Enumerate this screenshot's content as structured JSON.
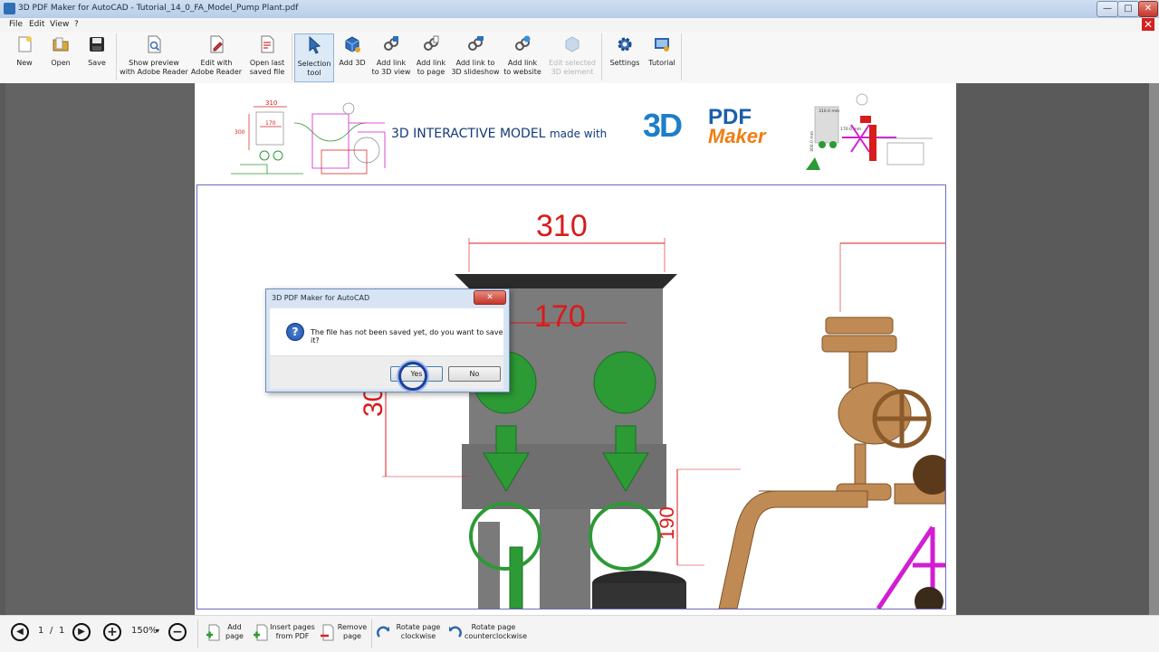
{
  "window": {
    "title": "3D PDF Maker for AutoCAD - Tutorial_14_0_FA_Model_Pump Plant.pdf",
    "controls": {
      "minimize": "—",
      "maximize": "□",
      "close": "✕"
    }
  },
  "menu": {
    "items": [
      "File",
      "Edit",
      "View",
      "?"
    ],
    "doc_close": "✕"
  },
  "toolbar": {
    "items": [
      {
        "label_1": "New",
        "label_2": "",
        "icon": "new-file-icon"
      },
      {
        "label_1": "Open",
        "label_2": "",
        "icon": "open-folder-icon"
      },
      {
        "label_1": "Save",
        "label_2": "",
        "icon": "save-disk-icon"
      },
      {
        "label_1": "Show preview",
        "label_2": "with Adobe Reader",
        "icon": "preview-pdf-icon"
      },
      {
        "label_1": "Edit with",
        "label_2": "Adobe Reader",
        "icon": "edit-pdf-icon"
      },
      {
        "label_1": "Open last",
        "label_2": "saved file",
        "icon": "open-last-icon"
      },
      {
        "label_1": "Selection",
        "label_2": "tool",
        "icon": "cursor-arrow-icon"
      },
      {
        "label_1": "Add 3D",
        "label_2": "",
        "icon": "add-3d-cube-icon"
      },
      {
        "label_1": "Add link",
        "label_2": "to 3D view",
        "icon": "link-3d-view-icon"
      },
      {
        "label_1": "Add link",
        "label_2": "to page",
        "icon": "link-page-icon"
      },
      {
        "label_1": "Add link to",
        "label_2": "3D slideshow",
        "icon": "link-slideshow-icon"
      },
      {
        "label_1": "Add link",
        "label_2": "to website",
        "icon": "link-website-icon"
      },
      {
        "label_1": "Edit selected",
        "label_2": "3D element",
        "icon": "edit-3d-element-icon"
      },
      {
        "label_1": "Settings",
        "label_2": "",
        "icon": "gear-icon"
      },
      {
        "label_1": "Tutorial",
        "label_2": "",
        "icon": "tutorial-icon"
      }
    ]
  },
  "document": {
    "banner_title": "3D INTERACTIVE MODEL",
    "banner_suffix": "made with",
    "brand": {
      "mark": "3D",
      "line1": "PDF",
      "line2": "Maker"
    },
    "dimensions": [
      "310",
      "170",
      "300",
      "190"
    ],
    "thumb_dims": {
      "left": [
        "310",
        "170",
        "300"
      ],
      "right": [
        "310.0 mm",
        "170.0 mm",
        "300.0 mm"
      ]
    }
  },
  "dialog": {
    "title": "3D PDF Maker for AutoCAD",
    "close": "✕",
    "icon": "question-icon",
    "icon_glyph": "?",
    "message": "The file has not been saved yet, do you want to save it?",
    "yes_label": "Yes",
    "no_label": "No"
  },
  "statusbar": {
    "current_page": "1",
    "page_sep": "/",
    "total_pages": "1",
    "zoom": "150%",
    "zoom_caret": "▾",
    "prev_glyph": "◀",
    "next_glyph": "▶",
    "zoom_in_glyph": "+",
    "zoom_out_glyph": "−",
    "tools": [
      {
        "label_1": "Add",
        "label_2": "page",
        "icon": "add-page-icon"
      },
      {
        "label_1": "Insert pages",
        "label_2": "from PDF",
        "icon": "insert-pages-icon"
      },
      {
        "label_1": "Remove",
        "label_2": "page",
        "icon": "remove-page-icon"
      },
      {
        "label_1": "Rotate page",
        "label_2": "clockwise",
        "icon": "rotate-cw-icon"
      },
      {
        "label_1": "Rotate page",
        "label_2": "counterclockwise",
        "icon": "rotate-ccw-icon"
      }
    ]
  },
  "colors": {
    "dimension_red": "#d81b1b",
    "pipe_green": "#2c9a35",
    "copper": "#c08a55",
    "magenta": "#d21ed2",
    "brand_blue": "#1a5fab",
    "brand_orange": "#ef7d11"
  }
}
